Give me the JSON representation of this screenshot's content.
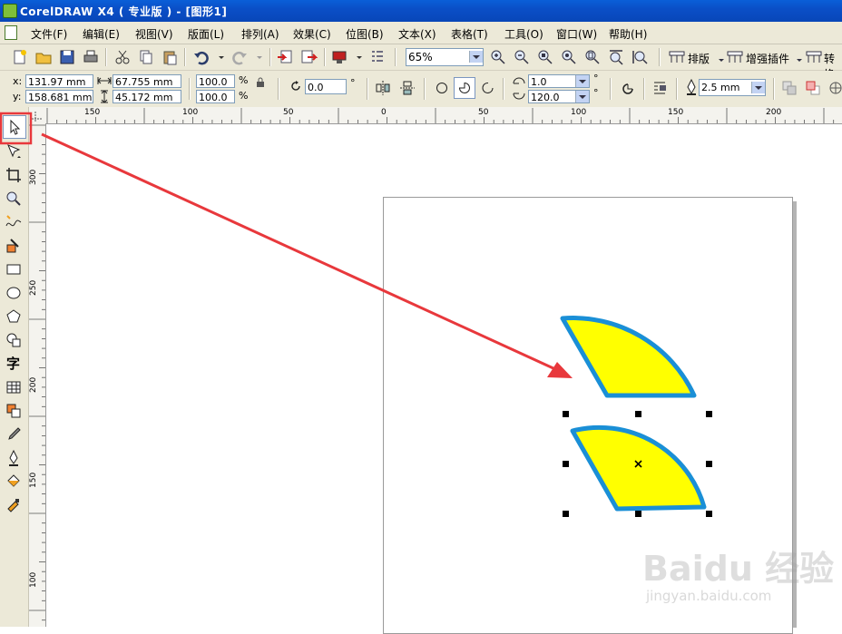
{
  "title": "CorelDRAW X4 ( 专业版 ) - [图形1]",
  "menu": [
    "文件(F)",
    "编辑(E)",
    "视图(V)",
    "版面(L)",
    "排列(A)",
    "效果(C)",
    "位图(B)",
    "文本(X)",
    "表格(T)",
    "工具(O)",
    "窗口(W)",
    "帮助(H)"
  ],
  "std_toolbar": {
    "zoom": "65%",
    "btn_layout": "排版",
    "btn_plugin": "增强插件",
    "btn_convert": "转换"
  },
  "props": {
    "x_label": "x:",
    "x_value": "131.97 mm",
    "y_label": "y:",
    "y_value": "158.681 mm",
    "w_value": "67.755 mm",
    "h_value": "45.172 mm",
    "scale_x": "100.0",
    "scale_y": "100.0",
    "pct": "%",
    "pct2": "%",
    "rotation": "0.0",
    "deg": "°",
    "start_angle": "1.0",
    "end_angle": "120.0",
    "outline_width": "2.5 mm"
  },
  "hruler_labels": [
    "150",
    "100",
    "50",
    "0",
    "50",
    "100",
    "150",
    "200"
  ],
  "vruler_labels": [
    "300",
    "250",
    "200",
    "150",
    "100"
  ],
  "watermark": "Baidu 经验",
  "watermark_sub": "jingyan.baidu.com",
  "colors": {
    "pie_fill": "#ffff00",
    "pie_outline": "#1a8fd6",
    "annotation": "#e8383c"
  },
  "tools": [
    "pick-icon",
    "shape-icon",
    "crop-icon",
    "zoom-icon",
    "freehand-icon",
    "smartfill-icon",
    "rectangle-icon",
    "ellipse-icon",
    "polygon-icon",
    "basicshapes-icon",
    "text-icon",
    "table-icon",
    "interactive-icon",
    "eyedropper-icon",
    "outline-icon",
    "fill-icon",
    "interactive-fill-icon"
  ]
}
